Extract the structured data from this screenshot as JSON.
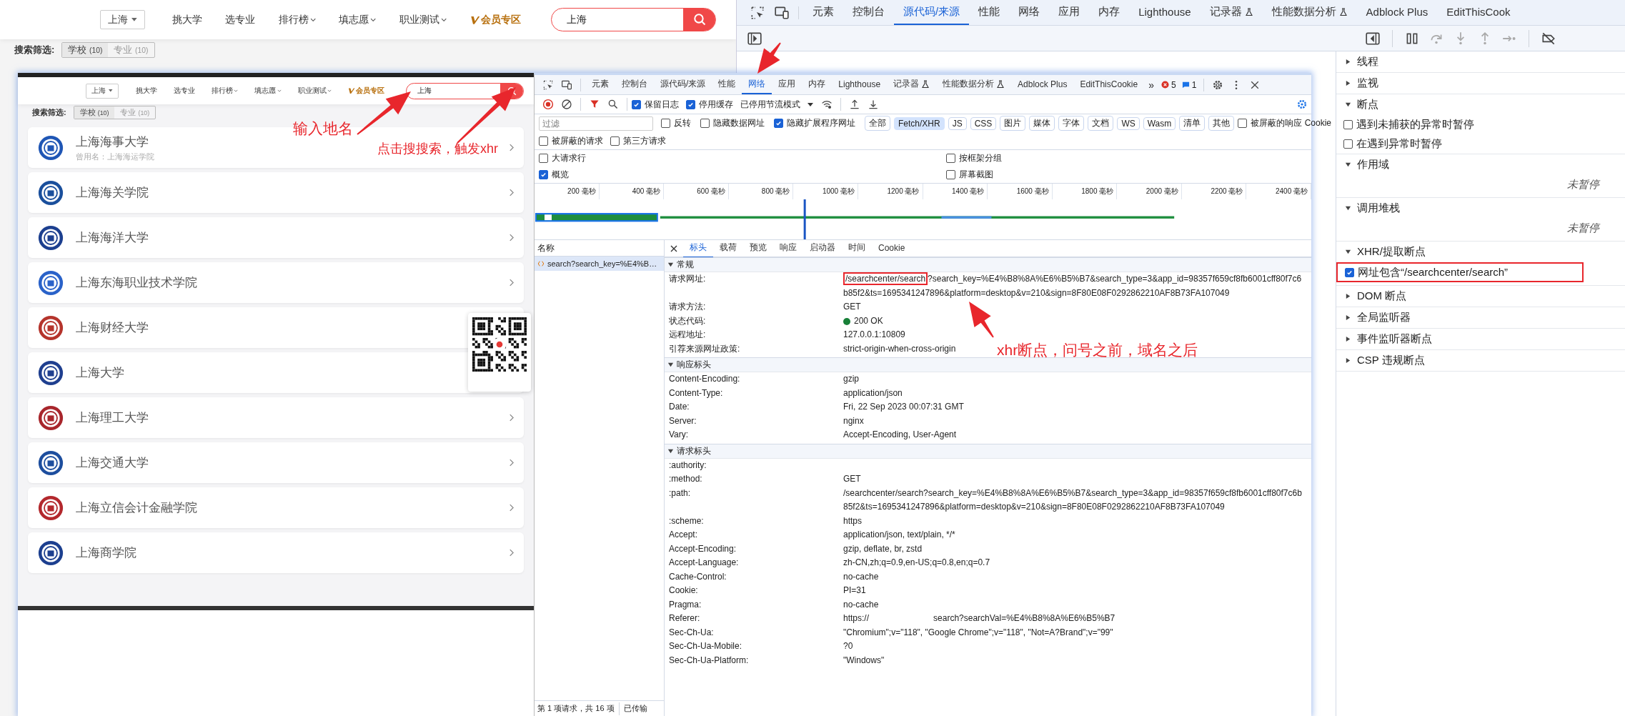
{
  "site": {
    "city": "上海",
    "nav": [
      {
        "label": "挑大学",
        "dropdown": false
      },
      {
        "label": "选专业",
        "dropdown": false
      },
      {
        "label": "排行榜",
        "dropdown": true
      },
      {
        "label": "填志愿",
        "dropdown": true
      },
      {
        "label": "职业测试",
        "dropdown": true
      }
    ],
    "vip": "会员专区",
    "search_value": "上海",
    "filter_label": "搜索筛选:",
    "filters": [
      {
        "label": "学校",
        "count": "(10)",
        "selected": true
      },
      {
        "label": "专业",
        "count": "(10)",
        "selected": false
      }
    ]
  },
  "devtools": {
    "tabs": [
      {
        "label": "元素",
        "selected": false,
        "kind": "plain"
      },
      {
        "label": "控制台",
        "selected": false,
        "kind": "plain"
      },
      {
        "label": "源代码/来源",
        "selected": true,
        "kind": "plain"
      },
      {
        "label": "性能",
        "selected": false,
        "kind": "plain"
      },
      {
        "label": "网络",
        "selected": false,
        "kind": "plain"
      },
      {
        "label": "应用",
        "selected": false,
        "kind": "plain"
      },
      {
        "label": "内存",
        "selected": false,
        "kind": "plain"
      },
      {
        "label": "Lighthouse",
        "selected": false,
        "kind": "plain"
      },
      {
        "label": "记录器",
        "selected": false,
        "kind": "experimental"
      },
      {
        "label": "性能数据分析",
        "selected": false,
        "kind": "experimental"
      },
      {
        "label": "Adblock Plus",
        "selected": false,
        "kind": "plain"
      },
      {
        "label": "EditThisCook",
        "selected": false,
        "kind": "plain"
      }
    ]
  },
  "debugger_sidebar": {
    "sections": [
      {
        "title": "线程",
        "expanded": false
      },
      {
        "title": "监视",
        "expanded": false
      },
      {
        "title": "断点",
        "expanded": true,
        "items": [
          {
            "kind": "checkbox",
            "label": "遇到未捕获的异常时暂停",
            "checked": false,
            "highlighted": false
          },
          {
            "kind": "checkbox",
            "label": "在遇到异常时暂停",
            "checked": false,
            "highlighted": false
          }
        ]
      },
      {
        "title": "作用域",
        "expanded": true,
        "items": [
          {
            "kind": "note",
            "label": "未暂停"
          }
        ]
      },
      {
        "title": "调用堆栈",
        "expanded": true,
        "items": [
          {
            "kind": "note",
            "label": "未暂停"
          }
        ]
      },
      {
        "title": "XHR/提取断点",
        "expanded": true,
        "items": [
          {
            "kind": "checkbox",
            "label": "网址包含“/searchcenter/search”",
            "checked": true,
            "highlighted": true
          }
        ]
      },
      {
        "title": "DOM 断点",
        "expanded": false
      },
      {
        "title": "全局监听器",
        "expanded": false
      },
      {
        "title": "事件监听器断点",
        "expanded": false
      },
      {
        "title": "CSP 违规断点",
        "expanded": false
      }
    ]
  },
  "inset": {
    "site": {
      "city": "上海",
      "nav": [
        {
          "label": "挑大学",
          "dropdown": false
        },
        {
          "label": "选专业",
          "dropdown": false
        },
        {
          "label": "排行榜",
          "dropdown": true
        },
        {
          "label": "填志愿",
          "dropdown": true
        },
        {
          "label": "职业测试",
          "dropdown": true
        }
      ],
      "vip": "会员专区",
      "search_value": "上海",
      "filter_label": "搜索筛选:",
      "filters": [
        {
          "label": "学校",
          "count": "(10)",
          "selected": true
        },
        {
          "label": "专业",
          "count": "(10)",
          "selected": false
        }
      ]
    },
    "universities": [
      {
        "name": "上海海事大学",
        "former_name": "曾用名：上海海运学院",
        "color": "#1f56b5"
      },
      {
        "name": "上海海关学院",
        "color": "#1a4f9c"
      },
      {
        "name": "上海海洋大学",
        "color": "#1c3f8f"
      },
      {
        "name": "上海东海职业技术学院",
        "color": "#2a62c9"
      },
      {
        "name": "上海财经大学",
        "color": "#b5342c",
        "chevron": false
      },
      {
        "name": "上海大学",
        "color": "#1f3f8f",
        "chevron": false
      },
      {
        "name": "上海理工大学",
        "color": "#a8262c"
      },
      {
        "name": "上海交通大学",
        "color": "#1d4e9e"
      },
      {
        "name": "上海立信会计金融学院",
        "color": "#b3282d"
      },
      {
        "name": "上海商学院",
        "color": "#1c3f8f"
      }
    ],
    "devtools": {
      "tabs": [
        {
          "label": "元素",
          "selected": false,
          "kind": "plain"
        },
        {
          "label": "控制台",
          "selected": false,
          "kind": "plain"
        },
        {
          "label": "源代码/来源",
          "selected": false,
          "kind": "plain"
        },
        {
          "label": "性能",
          "selected": false,
          "kind": "plain"
        },
        {
          "label": "网络",
          "selected": true,
          "kind": "plain"
        },
        {
          "label": "应用",
          "selected": false,
          "kind": "plain"
        },
        {
          "label": "内存",
          "selected": false,
          "kind": "plain"
        },
        {
          "label": "Lighthouse",
          "selected": false,
          "kind": "plain"
        },
        {
          "label": "记录器",
          "selected": false,
          "kind": "experimental"
        },
        {
          "label": "性能数据分析",
          "selected": false,
          "kind": "experimental"
        },
        {
          "label": "Adblock Plus",
          "selected": false,
          "kind": "plain"
        },
        {
          "label": "EditThisCookie",
          "selected": false,
          "kind": "plain"
        }
      ],
      "more": "»",
      "errors": "5",
      "messages": "1",
      "toolbar": {
        "checks": [
          {
            "label": "保留日志",
            "checked": true
          },
          {
            "label": "停用缓存",
            "checked": true
          }
        ],
        "throttling": "已停用节流模式"
      },
      "filter": {
        "placeholder": "过滤",
        "checks": [
          {
            "label": "反转",
            "checked": false
          },
          {
            "label": "隐藏数据网址",
            "checked": false
          },
          {
            "label": "隐藏扩展程序网址",
            "checked": true
          }
        ],
        "types": [
          {
            "label": "全部",
            "selected": false
          },
          {
            "label": "Fetch/XHR",
            "selected": true
          },
          {
            "label": "JS",
            "selected": false
          },
          {
            "label": "CSS",
            "selected": false
          },
          {
            "label": "图片",
            "selected": false
          },
          {
            "label": "媒体",
            "selected": false
          },
          {
            "label": "字体",
            "selected": false
          },
          {
            "label": "文档",
            "selected": false
          },
          {
            "label": "WS",
            "selected": false
          },
          {
            "label": "Wasm",
            "selected": false
          },
          {
            "label": "清单",
            "selected": false
          },
          {
            "label": "其他",
            "selected": false
          }
        ],
        "blocked_cookies": {
          "label": "被屏蔽的响应 Cookie",
          "checked": false
        },
        "row2": [
          {
            "label": "被屏蔽的请求",
            "checked": false
          },
          {
            "label": "第三方请求",
            "checked": false
          }
        ]
      },
      "options": [
        {
          "label": "大请求行",
          "checked": false
        },
        {
          "label": "按框架分组",
          "checked": false
        },
        {
          "label": "概览",
          "checked": true
        },
        {
          "label": "屏幕截图",
          "checked": false
        }
      ],
      "overview_ticks": [
        "200 毫秒",
        "400 毫秒",
        "600 毫秒",
        "800 毫秒",
        "1000 毫秒",
        "1200 毫秒",
        "1400 毫秒",
        "1600 毫秒",
        "1800 毫秒",
        "2000 毫秒",
        "2200 毫秒",
        "2400 毫秒"
      ],
      "requests": {
        "header": "名称",
        "rows": [
          {
            "name": "search?search_key=%E4%B…",
            "selected": true
          }
        ],
        "status": "第 1 项请求，共 16 项",
        "transferred": "已传输"
      },
      "details": {
        "tabs": [
          {
            "label": "标头",
            "selected": true
          },
          {
            "label": "载荷",
            "selected": false
          },
          {
            "label": "预览",
            "selected": false
          },
          {
            "label": "响应",
            "selected": false
          },
          {
            "label": "启动器",
            "selected": false
          },
          {
            "label": "时间",
            "selected": false
          },
          {
            "label": "Cookie",
            "selected": false
          }
        ],
        "sections": [
          {
            "title": "常规",
            "expanded": true,
            "rows": [
              {
                "name": "请求网址:",
                "highlight": "/searchcenter/search",
                "value": "?search_key=%E4%B8%8A%E6%B5%B7&search_type=3&app_id=98357f659cf8fb6001cff80f7c6b85f2&ts=1695341247896&platform=desktop&v=210&sign=8F80E08F0292862210AF8B73FA107049"
              },
              {
                "name": "请求方法:",
                "value": "GET"
              },
              {
                "name": "状态代码:",
                "value": "200 OK",
                "color": "#188038"
              },
              {
                "name": "远程地址:",
                "value": "127.0.0.1:10809"
              },
              {
                "name": "引荐来源网址政策:",
                "value": "strict-origin-when-cross-origin"
              }
            ]
          },
          {
            "title": "响应标头",
            "expanded": true,
            "rows": [
              {
                "name": "Content-Encoding:",
                "value": "gzip"
              },
              {
                "name": "Content-Type:",
                "value": "application/json"
              },
              {
                "name": "Date:",
                "value": "Fri, 22 Sep 2023 00:07:31 GMT"
              },
              {
                "name": "Server:",
                "value": "nginx"
              },
              {
                "name": "Vary:",
                "value": "Accept-Encoding, User-Agent"
              }
            ]
          },
          {
            "title": "请求标头",
            "expanded": true,
            "rows": [
              {
                "name": ":authority:"
              },
              {
                "name": ":method:",
                "value": "GET"
              },
              {
                "name": ":path:",
                "value": "/searchcenter/search?search_key=%E4%B8%8A%E6%B5%B7&search_type=3&app_id=98357f659cf8fb6001cff80f7c6b85f2&ts=1695341247896&platform=desktop&v=210&sign=8F80E08F0292862210AF8B73FA107049"
              },
              {
                "name": ":scheme:",
                "value": "https"
              },
              {
                "name": "Accept:",
                "value": "application/json, text/plain, */*"
              },
              {
                "name": "Accept-Encoding:",
                "value": "gzip, deflate, br, zstd"
              },
              {
                "name": "Accept-Language:",
                "value": "zh-CN,zh;q=0.9,en-US;q=0.8,en;q=0.7"
              },
              {
                "name": "Cache-Control:",
                "value": "no-cache"
              },
              {
                "name": "Cookie:",
                "value": "PI=31"
              },
              {
                "name": "Pragma:",
                "value": "no-cache"
              },
              {
                "name": "Referer:",
                "value": "https://",
                "value_2": "search?searchVal=%E4%B8%8A%E6%B5%B7"
              },
              {
                "name": "Sec-Ch-Ua:",
                "value": "\"Chromium\";v=\"118\", \"Google Chrome\";v=\"118\", \"Not=A?Brand\";v=\"99\""
              },
              {
                "name": "Sec-Ch-Ua-Mobile:",
                "value": "?0"
              },
              {
                "name": "Sec-Ch-Ua-Platform:",
                "value": "\"Windows\""
              }
            ]
          }
        ]
      }
    }
  },
  "annotations": [
    {
      "text": "输入地名"
    },
    {
      "text": "点击搜搜索，触发xhr"
    },
    {
      "text": "xhr断点，问号之前，域名之后"
    }
  ]
}
